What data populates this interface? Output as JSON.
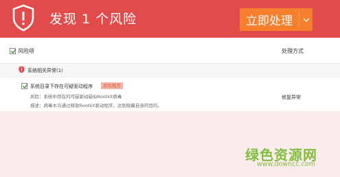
{
  "header": {
    "title": "发现 1 个风险",
    "action_label": "立即处理"
  },
  "columns": {
    "risk_label": "风险项",
    "method_label": "处理方式"
  },
  "group": {
    "label": "系统相关异常(1)"
  },
  "item": {
    "title": "系统目录下存在可疑驱动程序",
    "badge": "风险程序",
    "risk": "风险：系统中存在的可疑驱动疑似Rootkit病毒",
    "desc": "描述：病毒木马通过释放Rootkit驱动程序，达到隐藏自身的目的。",
    "method": "修复异常"
  },
  "watermark": {
    "logo": "绿色资源网",
    "url": "www.downcc.com"
  },
  "colors": {
    "header_bg": "#e24b4b",
    "action_bg": "#f57f2c",
    "badge_bg": "#f2b6a8",
    "watermark": "#7fbf3d"
  }
}
